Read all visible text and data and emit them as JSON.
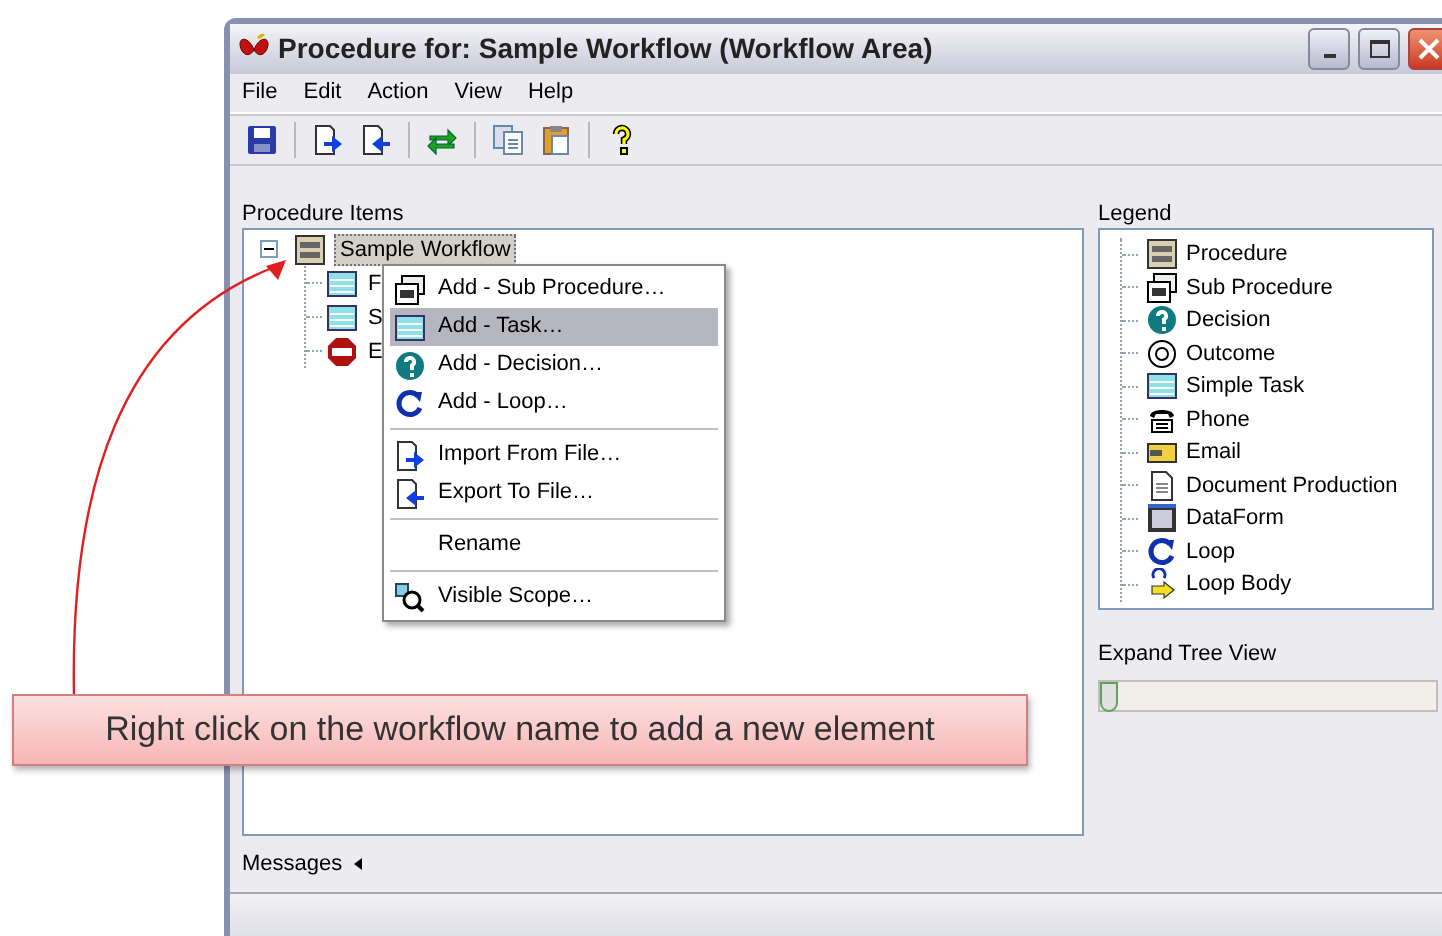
{
  "window": {
    "title": "Procedure for: Sample Workflow (Workflow Area)"
  },
  "menu_bar": [
    "File",
    "Edit",
    "Action",
    "View",
    "Help"
  ],
  "toolbar": [
    {
      "kind": "save"
    },
    {
      "kind": "sep"
    },
    {
      "kind": "import"
    },
    {
      "kind": "export"
    },
    {
      "kind": "sep"
    },
    {
      "kind": "sync"
    },
    {
      "kind": "sep"
    },
    {
      "kind": "copy"
    },
    {
      "kind": "paste"
    },
    {
      "kind": "sep"
    },
    {
      "kind": "help"
    }
  ],
  "procedure_items": {
    "label": "Procedure Items",
    "tree": [
      {
        "label": "Sample Workflow",
        "kind": "procedure",
        "expanded": true,
        "selected": true,
        "children": [
          {
            "label": "F",
            "kind": "task",
            "selected": false
          },
          {
            "label": "S",
            "kind": "task",
            "selected": false
          },
          {
            "label": "E",
            "kind": "end",
            "selected": false
          }
        ]
      }
    ]
  },
  "context_menu": [
    [
      {
        "label": "Add - Sub Procedure…",
        "kind": "subprocedure",
        "selected": false
      },
      {
        "label": "Add - Task…",
        "kind": "task",
        "selected": true
      },
      {
        "label": "Add - Decision…",
        "kind": "decision",
        "selected": false
      },
      {
        "label": "Add - Loop…",
        "kind": "loop",
        "selected": false
      }
    ],
    [
      {
        "label": "Import From File…",
        "kind": "import",
        "selected": false
      },
      {
        "label": "Export To File…",
        "kind": "export",
        "selected": false
      }
    ],
    [
      {
        "label": "Rename",
        "kind": "none",
        "selected": false
      }
    ],
    [
      {
        "label": "Visible Scope…",
        "kind": "scope",
        "selected": false
      }
    ]
  ],
  "legend": {
    "label": "Legend",
    "items": [
      {
        "label": "Procedure",
        "kind": "procedure"
      },
      {
        "label": "Sub Procedure",
        "kind": "subprocedure"
      },
      {
        "label": "Decision",
        "kind": "decision"
      },
      {
        "label": "Outcome",
        "kind": "outcome"
      },
      {
        "label": "Simple Task",
        "kind": "task"
      },
      {
        "label": "Phone",
        "kind": "phone"
      },
      {
        "label": "Email",
        "kind": "email"
      },
      {
        "label": "Document Production",
        "kind": "document"
      },
      {
        "label": "DataForm",
        "kind": "dataform"
      },
      {
        "label": "Loop",
        "kind": "loop"
      },
      {
        "label": "Loop Body",
        "kind": "loopbody"
      }
    ]
  },
  "expand_tree_view": {
    "label": "Expand Tree View",
    "level": 0
  },
  "messages": {
    "label": "Messages"
  },
  "callout": {
    "text": "Right click on the workflow name to add a new element"
  }
}
